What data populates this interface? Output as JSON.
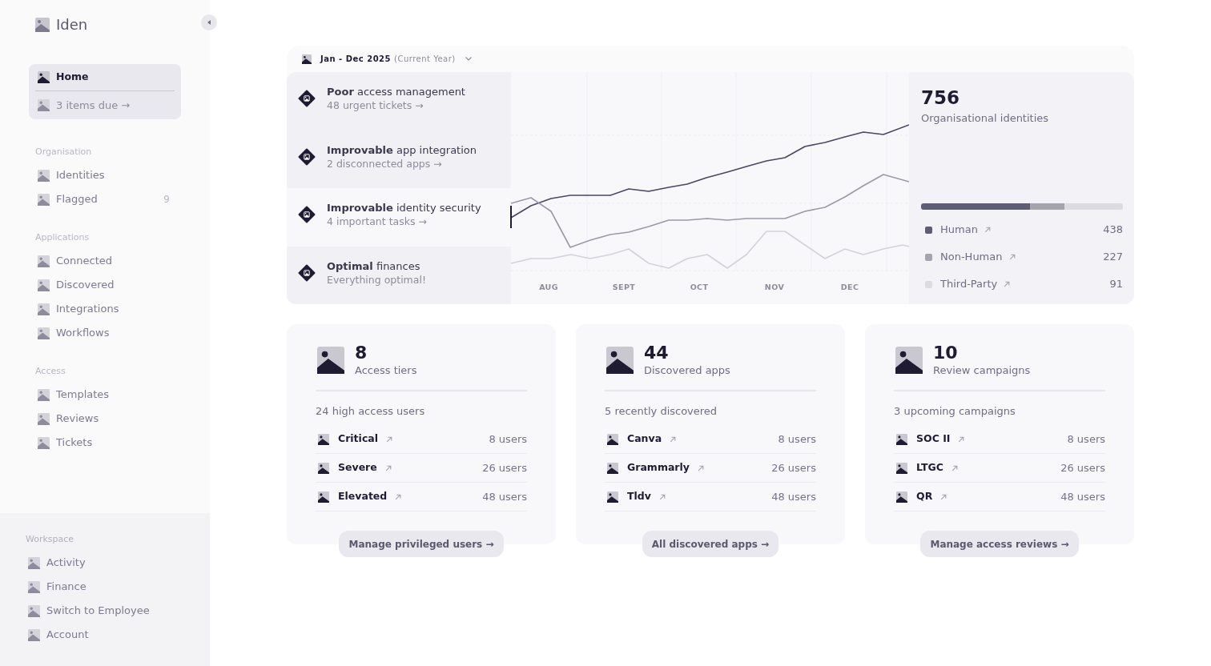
{
  "sidebar": {
    "logo": "Iden",
    "home": {
      "label": "Home",
      "selected": true,
      "due": "3 items due →"
    },
    "sections": [
      {
        "title": "Organisation",
        "items": [
          {
            "label": "Identities",
            "selected": false
          },
          {
            "label": "Flagged",
            "count": "9",
            "selected": false
          }
        ]
      },
      {
        "title": "Applications",
        "items": [
          {
            "label": "Connected",
            "selected": false
          },
          {
            "label": "Discovered",
            "selected": false
          },
          {
            "label": "Integrations",
            "selected": false
          },
          {
            "label": "Workflows",
            "selected": false
          }
        ]
      },
      {
        "title": "Access",
        "items": [
          {
            "label": "Templates",
            "selected": false
          },
          {
            "label": "Reviews",
            "selected": false
          },
          {
            "label": "Tickets",
            "selected": false
          }
        ]
      }
    ],
    "workspace": {
      "title": "Workspace",
      "items": [
        {
          "label": "Activity",
          "selected": false
        },
        {
          "label": "Finance",
          "selected": false
        },
        {
          "label": "Switch to Employee",
          "selected": false
        },
        {
          "label": "Account",
          "selected": false
        }
      ]
    }
  },
  "date_range": {
    "label": "Jan - Dec 2025",
    "note": "(Current Year)"
  },
  "insights": [
    {
      "title": "**Poor** access management",
      "detail": "48 urgent tickets →",
      "selected": false
    },
    {
      "title": "**Improvable** app integration",
      "detail": "2 disconnected apps →",
      "selected": false
    },
    {
      "title": "**Improvable** identity security",
      "detail": "4 important tasks →",
      "selected": true
    },
    {
      "title": "**Optimal** finances",
      "detail": "Everything optimal!",
      "selected": false
    }
  ],
  "trend_chart": {
    "month_labels": [
      "AUG",
      "SEPT",
      "OCT",
      "NOV",
      "DEC"
    ]
  },
  "identities": {
    "total": "756",
    "label": "Organisational identities",
    "groups": [
      {
        "name": "Human",
        "count": "438",
        "color": "#5f5d74",
        "level": 0.54
      },
      {
        "name": "Non-Human",
        "count": "227",
        "color": "#a4a3ae",
        "level": 0.17
      },
      {
        "name": "Third-Party",
        "count": "91",
        "color": "#dcdbe2",
        "level": 0.29
      }
    ]
  },
  "cards": [
    {
      "count": "8",
      "label": "Access tiers",
      "subtitle": "24 high access users",
      "rows": [
        {
          "name": "Critical",
          "users": "8 users"
        },
        {
          "name": "Severe",
          "users": "26 users"
        },
        {
          "name": "Elevated",
          "users": "48 users"
        }
      ],
      "button": "Manage privileged users →"
    },
    {
      "count": "44",
      "label": "Discovered apps",
      "subtitle": "5 recently discovered",
      "rows": [
        {
          "name": "Canva",
          "users": "8 users"
        },
        {
          "name": "Grammarly",
          "users": "26 users"
        },
        {
          "name": "Tldv",
          "users": "48 users"
        }
      ],
      "button": "All discovered apps →"
    },
    {
      "count": "10",
      "label": "Review campaigns",
      "subtitle": "3 upcoming campaigns",
      "rows": [
        {
          "name": "SOC II",
          "users": "8 users"
        },
        {
          "name": "LTGC",
          "users": "26 users"
        },
        {
          "name": "QR",
          "users": "48 users"
        }
      ],
      "button": "Manage access reviews →"
    }
  ]
}
